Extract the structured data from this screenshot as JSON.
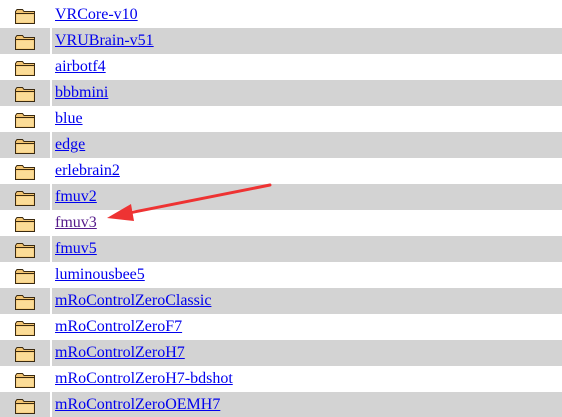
{
  "directory": {
    "folder_icon": "folder-icon",
    "link_color": "#0000ee",
    "visited_color": "#551a8b",
    "shade_color": "#d3d3d3",
    "entries": [
      {
        "name": "VRCore-v10",
        "visited": false
      },
      {
        "name": "VRUBrain-v51",
        "visited": false
      },
      {
        "name": "airbotf4",
        "visited": false
      },
      {
        "name": "bbbmini",
        "visited": false
      },
      {
        "name": "blue",
        "visited": false
      },
      {
        "name": "edge",
        "visited": false
      },
      {
        "name": "erlebrain2",
        "visited": false
      },
      {
        "name": "fmuv2",
        "visited": false
      },
      {
        "name": "fmuv3",
        "visited": true
      },
      {
        "name": "fmuv5",
        "visited": false
      },
      {
        "name": "luminousbee5",
        "visited": false
      },
      {
        "name": "mRoControlZeroClassic",
        "visited": false
      },
      {
        "name": "mRoControlZeroF7",
        "visited": false
      },
      {
        "name": "mRoControlZeroH7",
        "visited": false
      },
      {
        "name": "mRoControlZeroH7-bdshot",
        "visited": false
      },
      {
        "name": "mRoControlZeroOEMH7",
        "visited": false
      }
    ]
  },
  "annotation": {
    "type": "arrow",
    "color": "#ee3333",
    "target": "fmuv3"
  }
}
